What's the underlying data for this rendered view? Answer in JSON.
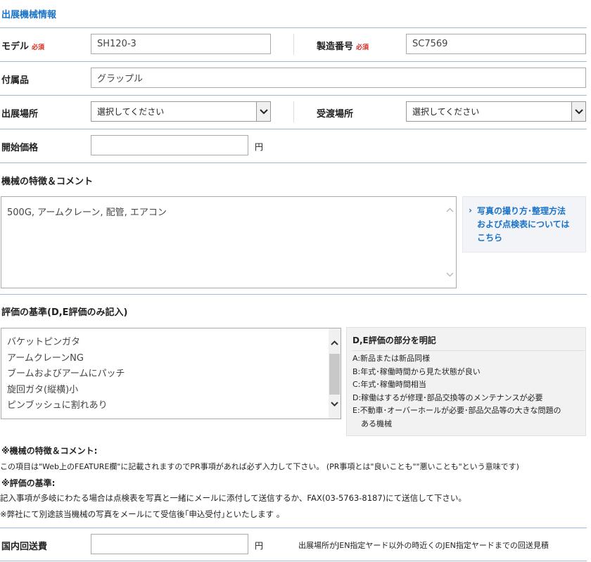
{
  "section": {
    "title": "出展機械情報"
  },
  "model": {
    "label": "モデル",
    "required": "必須",
    "value": "SH120-3"
  },
  "serial": {
    "label": "製造番号",
    "required": "必須",
    "value": "SC7569"
  },
  "accessory": {
    "label": "付属品",
    "value": "グラップル"
  },
  "exhibit_place": {
    "label": "出展場所",
    "selected": "選択してください"
  },
  "delivery_place": {
    "label": "受渡場所",
    "selected": "選択してください"
  },
  "start_price": {
    "label": "開始価格",
    "value": "",
    "unit": "円"
  },
  "features": {
    "label": "機械の特徴＆コメント",
    "value": "500G, アームクレーン, 配管, エアコン",
    "help_link": "写真の撮り方･整理方法および点検表についてはこちら",
    "help_lines": [
      "写真の撮り方･整理方法",
      "および点検表については",
      "こちら"
    ]
  },
  "criteria": {
    "label": "評価の基準(D,E評価のみ記入)",
    "items": [
      "バケットピンガタ",
      "アームクレーンNG",
      "ブームおよびアームにパッチ",
      "旋回ガタ(縦横)小",
      "ピンブッシュに割れあり"
    ],
    "box_title": "D,E評価の部分を明記",
    "grades": [
      "A:新品または新品同様",
      "B:年式･稼働時間から見た状態が良い",
      "C:年式･稼働時間相当",
      "D:稼働はするが修理･部品交換等のメンテナンスが必要",
      "E:不動車･オーバーホールが必要･部品欠品等の大きな問題の",
      "ある機械"
    ]
  },
  "notes": {
    "h1": "※機械の特徴＆コメント:",
    "t1": "この項目は\"Web上のFEATURE欄\"に記載されますのでPR事項があれば必ず入力して下さい。 (PR事項とは\"良いことも\"\"悪いことも\"という意味です)",
    "h2": "※評価の基準:",
    "t2": "記入事項が多岐にわたる場合は点検表を写真と一緒にメールに添付して送信するか、FAX(03-5763-8187)にて送信して下さい。",
    "t3": "※弊社にて別途該当機械の写真をメールにて受信後｢申込受付｣といたします 。"
  },
  "shipping": {
    "label": "国内回送費",
    "value": "",
    "unit": "円",
    "note": "出展場所がJEN指定ヤード以外の時近くのJEN指定ヤードまでの回送見積"
  }
}
